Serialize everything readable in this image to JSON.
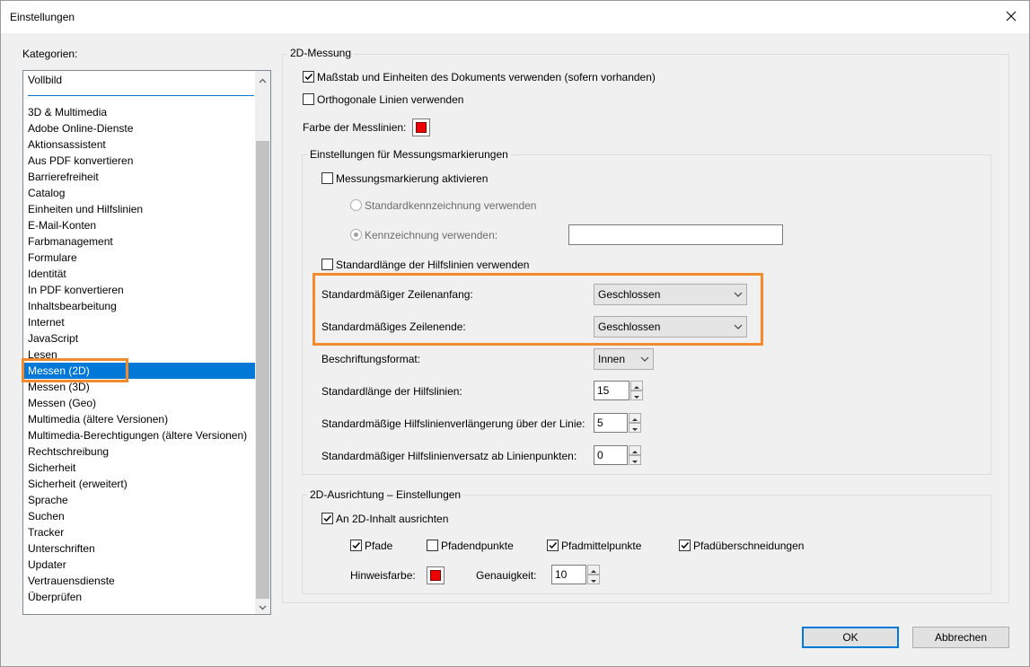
{
  "window": {
    "title": "Einstellungen"
  },
  "categories": {
    "label": "Kategorien:",
    "top_item": "Vollbild",
    "items": [
      "3D & Multimedia",
      "Adobe Online-Dienste",
      "Aktionsassistent",
      "Aus PDF konvertieren",
      "Barrierefreiheit",
      "Catalog",
      "Einheiten und Hilfslinien",
      "E-Mail-Konten",
      "Farbmanagement",
      "Formulare",
      "Identität",
      "In PDF konvertieren",
      "Inhaltsbearbeitung",
      "Internet",
      "JavaScript",
      "Lesen",
      "Messen (2D)",
      "Messen (3D)",
      "Messen (Geo)",
      "Multimedia (ältere Versionen)",
      "Multimedia-Berechtigungen (ältere Versionen)",
      "Rechtschreibung",
      "Sicherheit",
      "Sicherheit (erweitert)",
      "Sprache",
      "Suchen",
      "Tracker",
      "Unterschriften",
      "Updater",
      "Vertrauensdienste",
      "Überprüfen"
    ],
    "selected": "Messen (2D)"
  },
  "measure2d": {
    "group_title": "2D-Messung",
    "use_scale_label": "Maßstab und Einheiten des Dokuments verwenden (sofern vorhanden)",
    "use_scale_checked": true,
    "ortho_label": "Orthogonale Linien verwenden",
    "ortho_checked": false,
    "line_color_label": "Farbe der Messlinien:",
    "line_color": "#ee0000"
  },
  "markup": {
    "group_title": "Einstellungen für Messungsmarkierungen",
    "enable_label": "Messungsmarkierung aktivieren",
    "enable_checked": false,
    "std_label_radio": "Standardkennzeichnung verwenden",
    "custom_label_radio": "Kennzeichnung verwenden:",
    "custom_label_value": "",
    "std_leader_label": "Standardlänge der Hilfslinien verwenden",
    "std_leader_checked": false,
    "line_start_label": "Standardmäßiger Zeilenanfang:",
    "line_start_value": "Geschlossen",
    "line_end_label": "Standardmäßiges Zeilenende:",
    "line_end_value": "Geschlossen",
    "caption_format_label": "Beschriftungsformat:",
    "caption_format_value": "Innen",
    "leader_length_label": "Standardlänge der Hilfslinien:",
    "leader_length_value": "15",
    "leader_ext_label": "Standardmäßige Hilfslinienverlängerung über der Linie:",
    "leader_ext_value": "5",
    "leader_offset_label": "Standardmäßiger Hilfslinienversatz ab Linienpunkten:",
    "leader_offset_value": "0"
  },
  "snap": {
    "group_title": "2D-Ausrichtung – Einstellungen",
    "snap_label": "An 2D-Inhalt ausrichten",
    "snap_checked": true,
    "paths_label": "Pfade",
    "paths_checked": true,
    "endpoints_label": "Pfadendpunkte",
    "endpoints_checked": false,
    "midpoints_label": "Pfadmittelpunkte",
    "midpoints_checked": true,
    "intersections_label": "Pfadüberschneidungen",
    "intersections_checked": true,
    "hint_color_label": "Hinweisfarbe:",
    "hint_color": "#ee0000",
    "accuracy_label": "Genauigkeit:",
    "accuracy_value": "10"
  },
  "buttons": {
    "ok": "OK",
    "cancel": "Abbrechen"
  },
  "colors": {
    "accent": "#0078d7",
    "highlight": "#f28a2e"
  }
}
